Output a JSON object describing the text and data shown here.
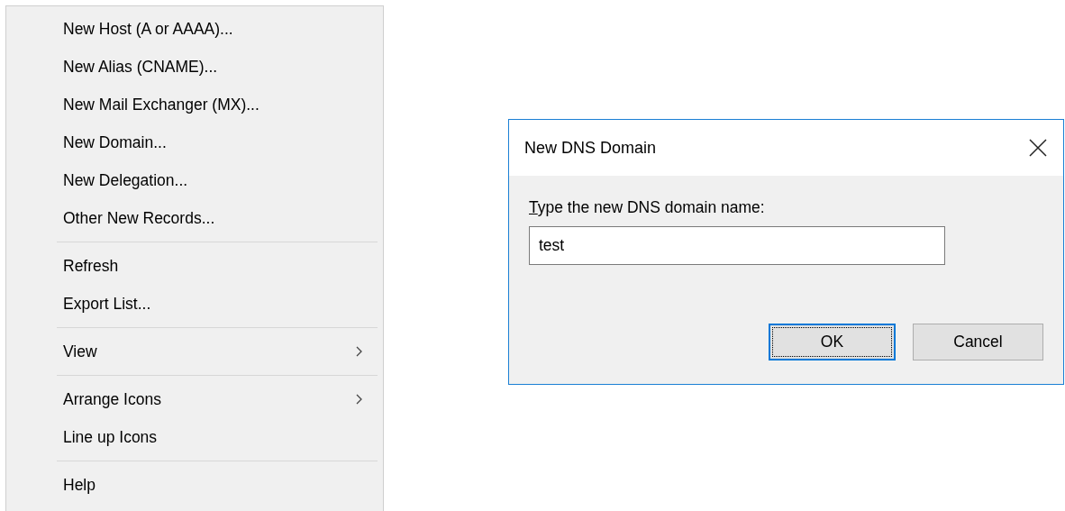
{
  "context_menu": {
    "groups": [
      [
        {
          "label": "New Host (A or AAAA)...",
          "submenu": false
        },
        {
          "label": "New Alias (CNAME)...",
          "submenu": false
        },
        {
          "label": "New Mail Exchanger (MX)...",
          "submenu": false
        },
        {
          "label": "New Domain...",
          "submenu": false
        },
        {
          "label": "New Delegation...",
          "submenu": false
        },
        {
          "label": "Other New Records...",
          "submenu": false
        }
      ],
      [
        {
          "label": "Refresh",
          "submenu": false
        },
        {
          "label": "Export List...",
          "submenu": false
        }
      ],
      [
        {
          "label": "View",
          "submenu": true
        }
      ],
      [
        {
          "label": "Arrange Icons",
          "submenu": true
        },
        {
          "label": "Line up Icons",
          "submenu": false
        }
      ],
      [
        {
          "label": "Help",
          "submenu": false
        }
      ]
    ]
  },
  "dialog": {
    "title": "New DNS Domain",
    "prompt": {
      "text": "Type the new DNS domain name:",
      "first_letter_underlined": true
    },
    "field": {
      "value": "test"
    },
    "buttons": [
      {
        "label": "OK",
        "default": true
      },
      {
        "label": "Cancel",
        "default": false
      }
    ]
  }
}
